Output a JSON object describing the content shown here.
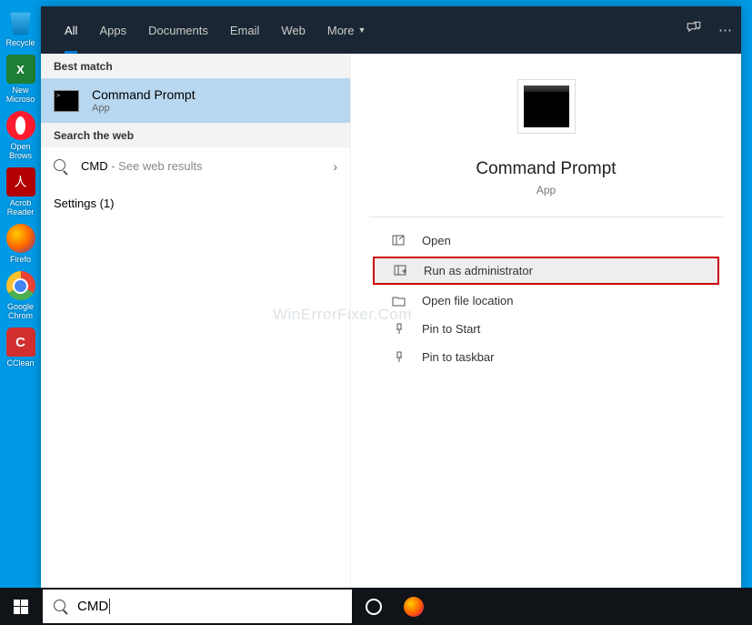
{
  "desktop": {
    "icons": [
      {
        "label": "Recycle"
      },
      {
        "label": "New Microso"
      },
      {
        "label": "Open Brows"
      },
      {
        "label": "Acrob Reader"
      },
      {
        "label": "Firefo"
      },
      {
        "label": "Google Chrom"
      },
      {
        "label": "CClean"
      }
    ]
  },
  "header": {
    "tabs": [
      "All",
      "Apps",
      "Documents",
      "Email",
      "Web",
      "More"
    ]
  },
  "left": {
    "best_match": "Best match",
    "result_title": "Command Prompt",
    "result_sub": "App",
    "search_web": "Search the web",
    "web_query": "CMD",
    "web_hint": " - See web results",
    "settings": "Settings (1)"
  },
  "detail": {
    "title": "Command Prompt",
    "sub": "App",
    "actions": [
      {
        "label": "Open",
        "hl": false
      },
      {
        "label": "Run as administrator",
        "hl": true
      },
      {
        "label": "Open file location",
        "hl": false
      },
      {
        "label": "Pin to Start",
        "hl": false
      },
      {
        "label": "Pin to taskbar",
        "hl": false
      }
    ]
  },
  "watermark": "WinErrorFixer.Com",
  "taskbar": {
    "search_value": "CMD"
  }
}
